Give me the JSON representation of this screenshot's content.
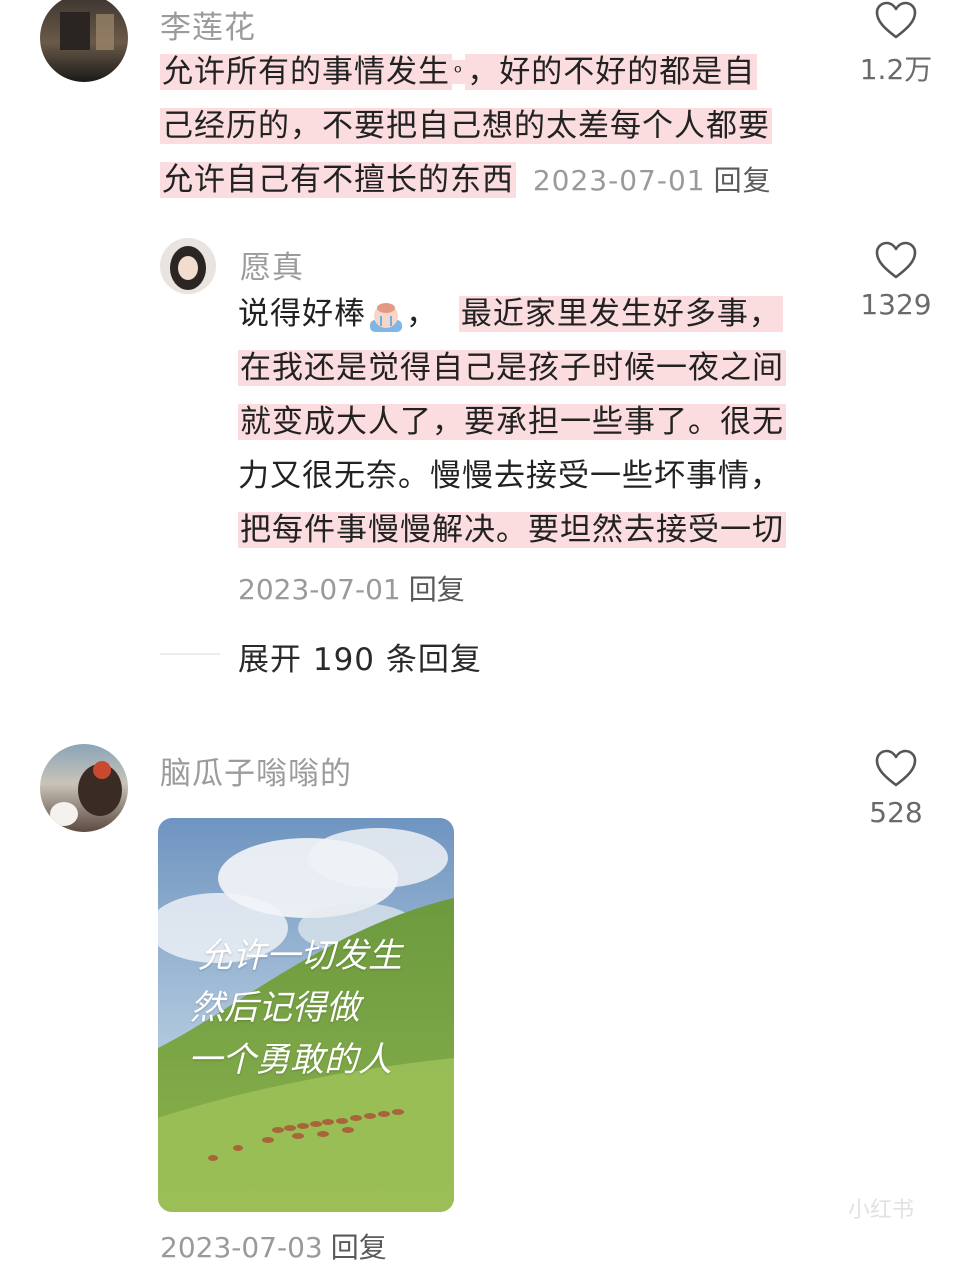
{
  "comments": [
    {
      "username": "李莲花",
      "lines": [
        "允许所有的事情发生",
        "，好的不好的都是自",
        "己经历的，不要把自己想的太差每个人都要",
        "允许自己有不擅长的东西"
      ],
      "date": "2023-07-01",
      "reply_label": "回复",
      "like_count": "1.2万"
    },
    {
      "username": "愿真",
      "lines": [
        "说得好棒",
        "，",
        "最近家里发生好多事，",
        "在我还是觉得自己是孩子时候一夜之间",
        "就变成大人了，要承担一些事了。很无",
        "力又很无奈。慢慢去接受一些坏事情，",
        "把每件事慢慢解决。要坦然去接受一切"
      ],
      "date": "2023-07-01",
      "reply_label": "回复",
      "like_count": "1329",
      "expand_label": "展开 190 条回复"
    },
    {
      "username": "脑瓜子嗡嗡的",
      "image_text": [
        "允许一切发生",
        "然后记得做",
        "一个勇敢的人"
      ],
      "date": "2023-07-03",
      "reply_label": "回复",
      "like_count": "528"
    }
  ],
  "watermark": "小红书",
  "colors": {
    "highlight": "#fbdde0",
    "muted": "#9b9b9b"
  },
  "icons": {
    "like": "heart-outline-icon",
    "search": "search-icon"
  }
}
